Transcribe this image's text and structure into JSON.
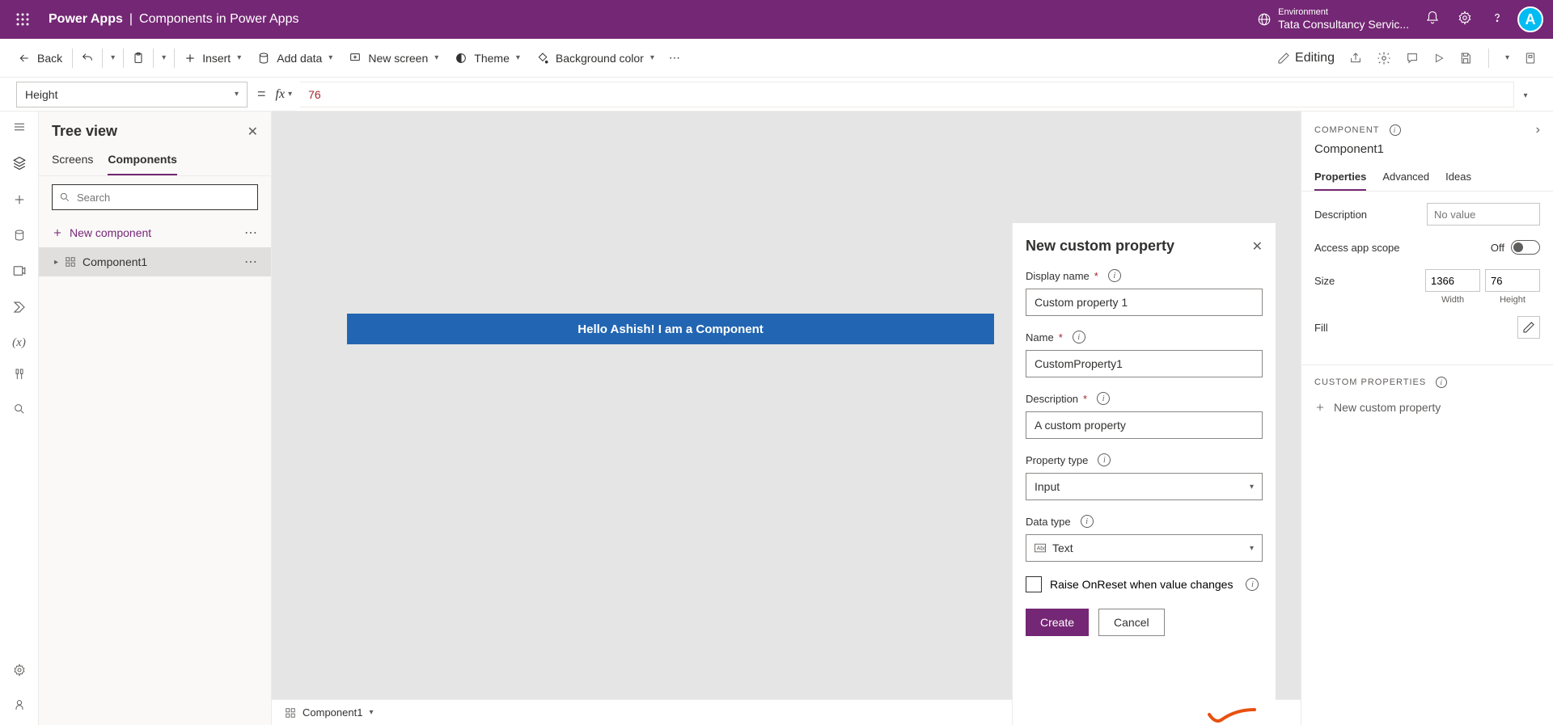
{
  "header": {
    "brand": "Power Apps",
    "app_name": "Components in Power Apps",
    "env_label": "Environment",
    "env_value": "Tata Consultancy Servic...",
    "avatar_initial": "A"
  },
  "cmdbar": {
    "back": "Back",
    "insert": "Insert",
    "add_data": "Add data",
    "new_screen": "New screen",
    "theme": "Theme",
    "bg_color": "Background color",
    "editing": "Editing"
  },
  "formula": {
    "property": "Height",
    "value": "76"
  },
  "tree": {
    "title": "Tree view",
    "tab_screens": "Screens",
    "tab_components": "Components",
    "search_placeholder": "Search",
    "new_component": "New component",
    "item1": "Component1"
  },
  "canvas": {
    "component_text": "Hello Ashish! I am a Component",
    "status_label": "Component1"
  },
  "custom_prop": {
    "title": "New custom property",
    "display_name_label": "Display name",
    "display_name_value": "Custom property 1",
    "name_label": "Name",
    "name_value": "CustomProperty1",
    "description_label": "Description",
    "description_value": "A custom property",
    "property_type_label": "Property type",
    "property_type_value": "Input",
    "data_type_label": "Data type",
    "data_type_value": "Text",
    "raise_onreset": "Raise OnReset when value changes",
    "create": "Create",
    "cancel": "Cancel"
  },
  "right_panel": {
    "section": "COMPONENT",
    "name": "Component1",
    "tab_properties": "Properties",
    "tab_advanced": "Advanced",
    "tab_ideas": "Ideas",
    "description_label": "Description",
    "description_placeholder": "No value",
    "access_scope_label": "Access app scope",
    "access_scope_value": "Off",
    "size_label": "Size",
    "width_value": "1366",
    "height_value": "76",
    "width_label": "Width",
    "height_label": "Height",
    "fill_label": "Fill",
    "custom_props_section": "CUSTOM PROPERTIES",
    "new_custom_property": "New custom property"
  }
}
